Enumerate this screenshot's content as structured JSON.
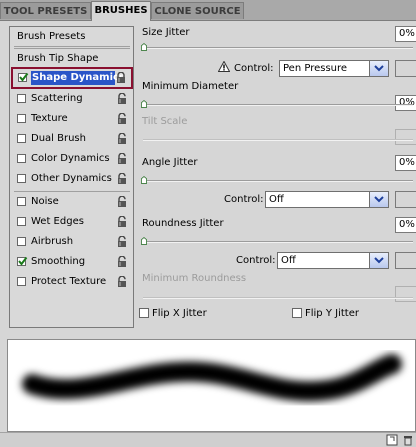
{
  "tabs": {
    "tool_presets": "TOOL PRESETS",
    "brushes": "BRUSHES",
    "clone_source": "CLONE SOURCE"
  },
  "left_panel": {
    "brush_presets": "Brush Presets",
    "brush_tip_shape": "Brush Tip Shape",
    "options": [
      {
        "label": "Shape Dynamics",
        "checked": true,
        "selected": true
      },
      {
        "label": "Scattering",
        "checked": false
      },
      {
        "label": "Texture",
        "checked": false
      },
      {
        "label": "Dual Brush",
        "checked": false
      },
      {
        "label": "Color Dynamics",
        "checked": false
      },
      {
        "label": "Other Dynamics",
        "checked": false
      },
      {
        "label": "Noise",
        "checked": false
      },
      {
        "label": "Wet Edges",
        "checked": false
      },
      {
        "label": "Airbrush",
        "checked": false
      },
      {
        "label": "Smoothing",
        "checked": true
      },
      {
        "label": "Protect Texture",
        "checked": false
      }
    ]
  },
  "right_panel": {
    "size_jitter": {
      "label": "Size Jitter",
      "value": "0%"
    },
    "size_control": {
      "label": "Control:",
      "value": "Pen Pressure"
    },
    "minimum_diameter": {
      "label": "Minimum Diameter",
      "value": "0%"
    },
    "tilt_scale": {
      "label": "Tilt Scale"
    },
    "angle_jitter": {
      "label": "Angle Jitter",
      "value": "0%"
    },
    "angle_control": {
      "label": "Control:",
      "value": "Off"
    },
    "roundness_jitter": {
      "label": "Roundness Jitter",
      "value": "0%"
    },
    "roundness_control": {
      "label": "Control:",
      "value": "Off"
    },
    "minimum_roundness": {
      "label": "Minimum Roundness"
    },
    "flip_x": {
      "label": "Flip X Jitter",
      "checked": false
    },
    "flip_y": {
      "label": "Flip Y Jitter",
      "checked": false
    }
  }
}
